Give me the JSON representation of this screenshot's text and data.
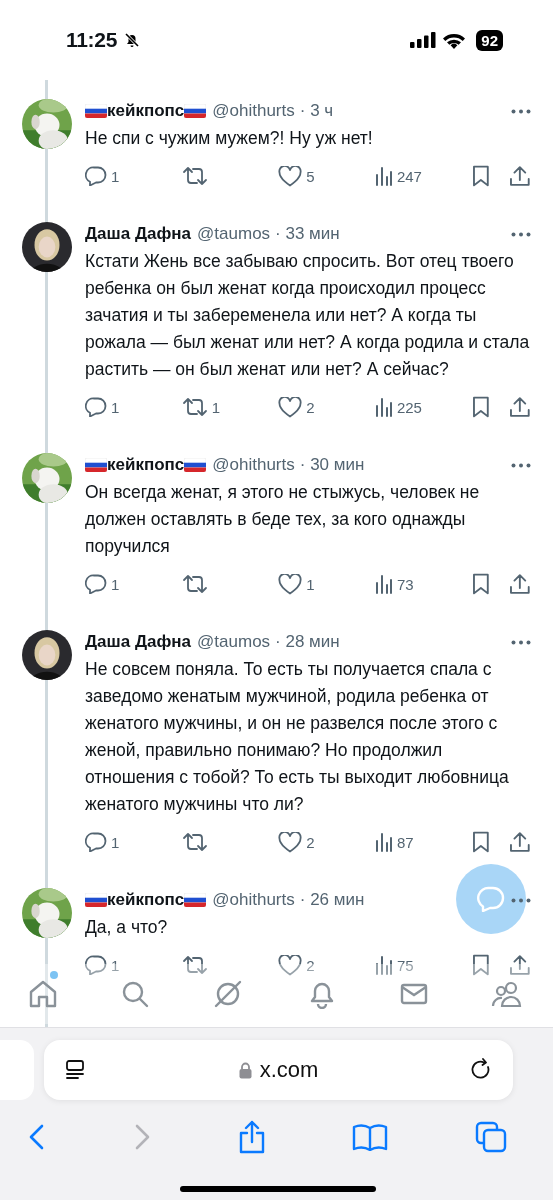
{
  "status_bar": {
    "time": "11:25",
    "battery": "92",
    "silenced": true
  },
  "tweets": [
    {
      "name": "кейкпопс",
      "flags": true,
      "handle": "@ohithurts",
      "time": "· 3 ч",
      "text": "Не спи с чужим мужем?! Ну уж нет!",
      "replies": "1",
      "likes": "5",
      "views": "247"
    },
    {
      "name": "Даша Дафна",
      "flags": false,
      "handle": "@taumos",
      "time": "· 33 мин",
      "text": "Кстати Жень все забываю спросить. Вот отец твоего ребенка он был женат когда происходил процесс зачатия и ты забеременела или нет? А когда ты рожала — был женат или нет? А когда родила и стала растить — он был женат или нет? А сейчас?",
      "replies": "1",
      "reposts": "1",
      "likes": "2",
      "views": "225"
    },
    {
      "name": "кейкпопс",
      "flags": true,
      "handle": "@ohithurts",
      "time": "· 30 мин",
      "text": "Он всегда женат, я этого не стыжусь, человек не должен оставлять в беде тех, за кого однажды поручился",
      "replies": "1",
      "likes": "1",
      "views": "73"
    },
    {
      "name": "Даша Дафна",
      "flags": false,
      "handle": "@taumos",
      "time": "· 28 мин",
      "text": "Не совсем поняла. То есть ты получается спала с заведомо женатым мужчиной, родила ребенка от женатого мужчины, и он не развелся после этого с женой, правильно понимаю? Но продолжил отношения с тобой? То есть ты выходит любовница женатого мужчины что ли?",
      "replies": "1",
      "likes": "2",
      "views": "87"
    },
    {
      "name": "кейкпопс",
      "flags": true,
      "handle": "@ohithurts",
      "time": "· 26 мин",
      "text": "Да, а что?",
      "replies": "1",
      "likes": "2",
      "views": "75"
    }
  ],
  "bottom_nav": {
    "home_badge": true
  },
  "browser": {
    "url": "x.com"
  }
}
